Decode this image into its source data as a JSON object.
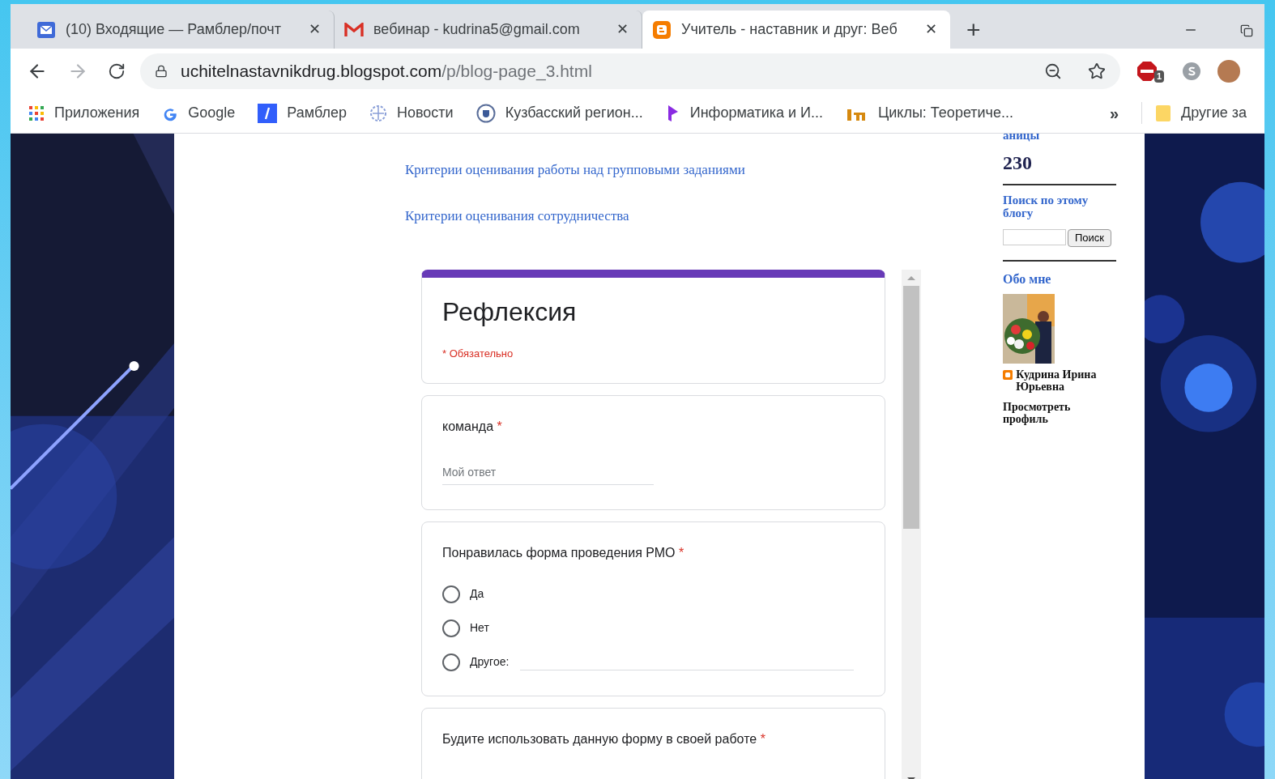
{
  "tabs": [
    {
      "title": "(10) Входящие — Рамблер/почт",
      "close": "✕",
      "selected": false
    },
    {
      "title": "вебинар - kudrina5@gmail.com",
      "close": "✕",
      "selected": false
    },
    {
      "title": "Учитель - наставник и друг: Веб",
      "close": "✕",
      "selected": true
    }
  ],
  "new_tab": "+",
  "address": {
    "host": "uchitelnastavnikdrug.blogspot.com",
    "path": "/p/blog-page_3.html"
  },
  "extension_badge": "1",
  "bookmarks": [
    "Приложения",
    "Google",
    "Рамблер",
    "Новости",
    "Кузбасский регион...",
    "Информатика и И...",
    "Циклы: Теоретиче..."
  ],
  "more_bookmarks": "»",
  "other_bookmarks": "Другие за",
  "links": [
    "Критерии оценивания работы над групповыми заданиями",
    "Критерии оценивания сотрудничества"
  ],
  "form": {
    "title": "Рефлексия",
    "required_note": "* Обязательно",
    "questions": [
      {
        "kind": "text",
        "label": "команда",
        "required_mark": "*",
        "placeholder": "Мой ответ"
      },
      {
        "kind": "choice",
        "label": "Понравилась форма проведения РМО",
        "required_mark": "*",
        "options": [
          {
            "kind": "plain",
            "label": "Да",
            "selected": false
          },
          {
            "kind": "plain",
            "label": "Нет",
            "selected": false
          },
          {
            "kind": "other",
            "label": "Другое:",
            "selected": false
          }
        ]
      },
      {
        "kind": "choice",
        "label": "Будите использовать данную форму в своей работе",
        "required_mark": "*"
      }
    ]
  },
  "sidebar": {
    "cut_heading": "аницы",
    "counter": "230",
    "search_heading": "Поиск по этому блогу",
    "search_button": "Поиск",
    "about_heading": "Обо мне",
    "author": "Кудрина Ирина Юрьевна",
    "profile_link": "Просмотреть профиль"
  }
}
